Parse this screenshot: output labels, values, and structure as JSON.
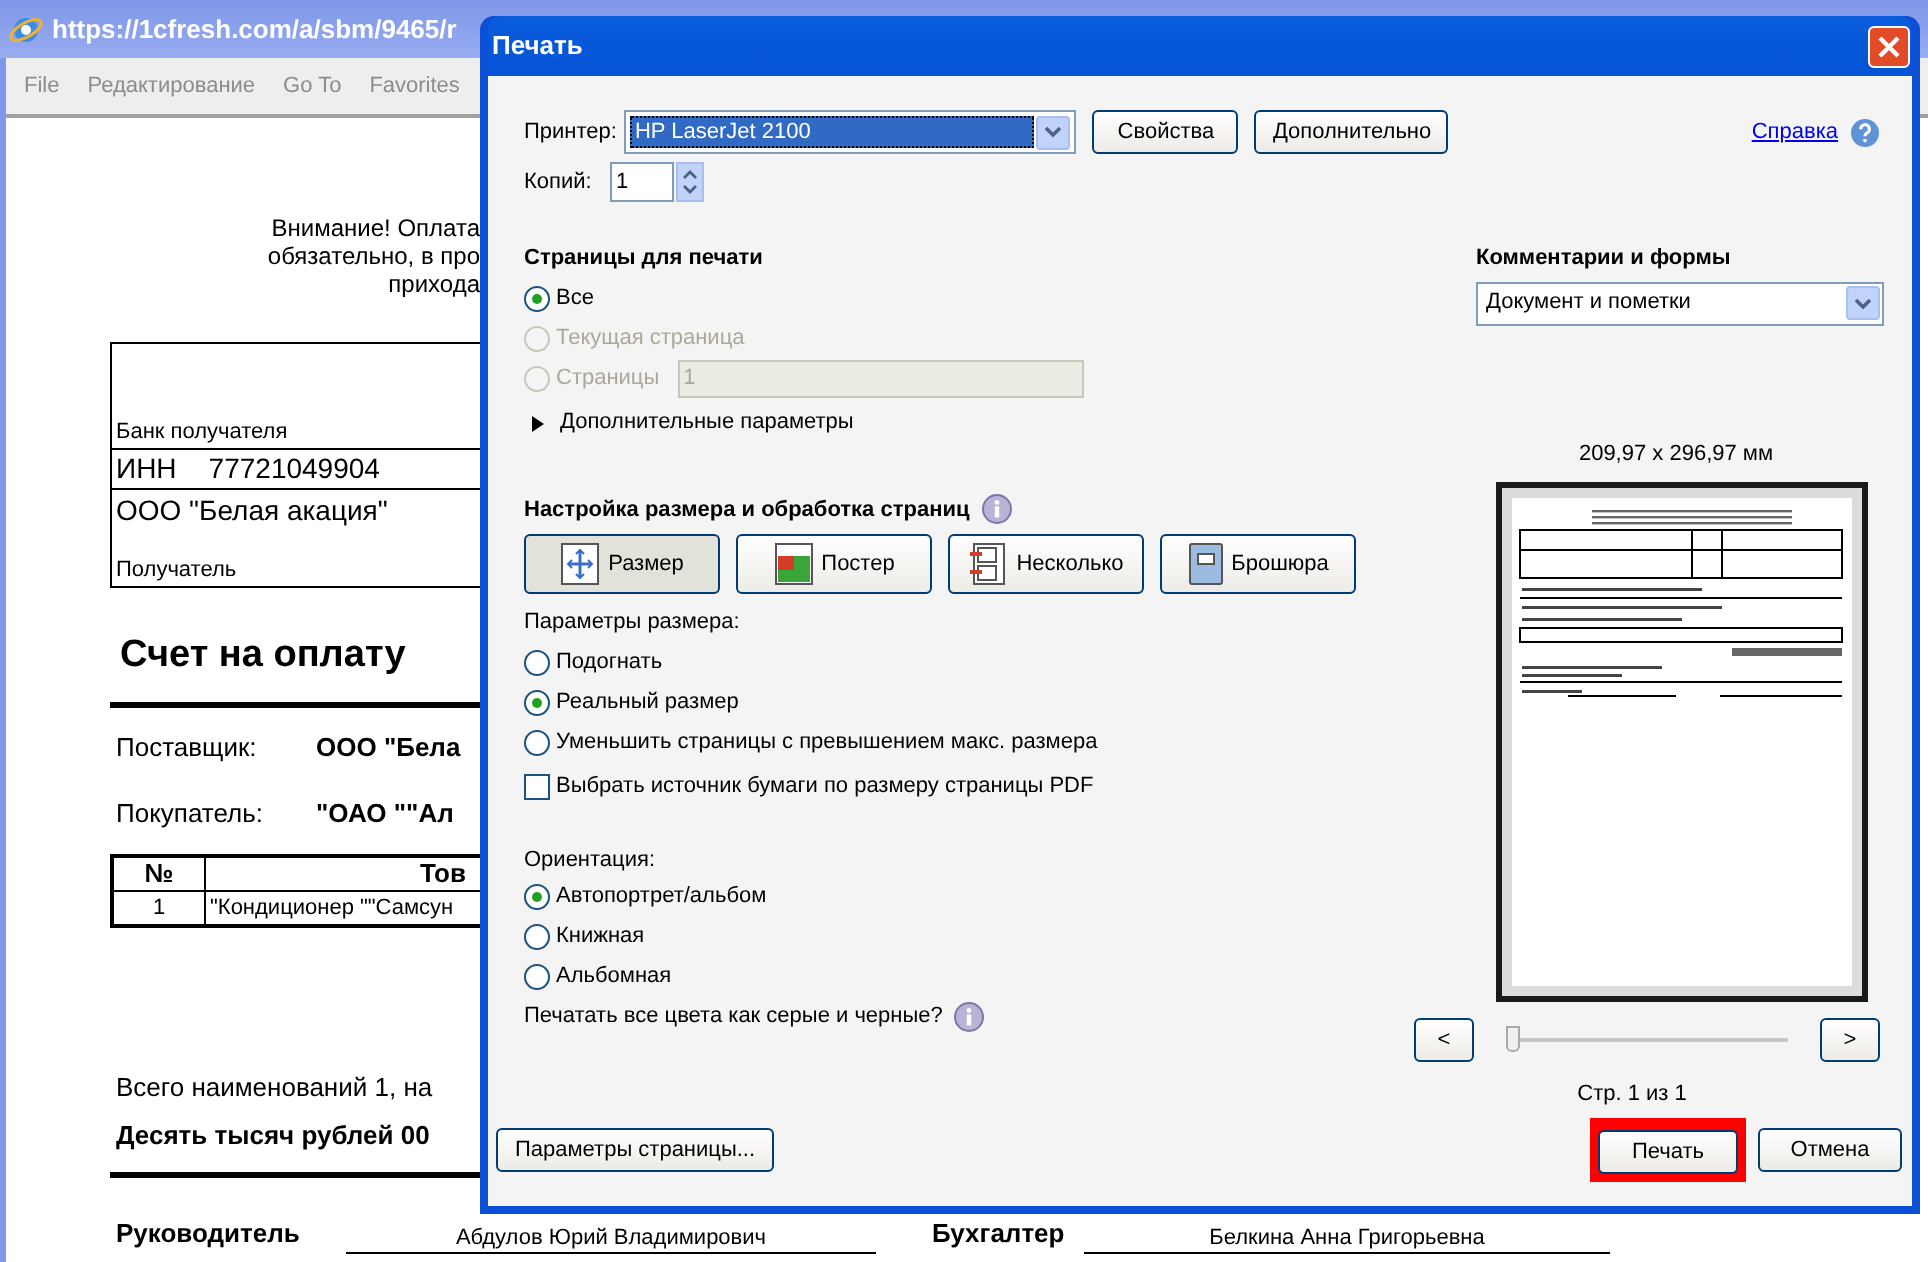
{
  "browser": {
    "address": "https://1cfresh.com/a/sbm/9465/r",
    "menu": [
      "File",
      "Редактирование",
      "Go To",
      "Favorites"
    ]
  },
  "document": {
    "notice": [
      "Внимание! Оплата",
      "обязательно, в про",
      "прихода"
    ],
    "bank_table": {
      "bank_label": "Банк получателя",
      "inn_label": "ИНН",
      "inn_value": "77721049904",
      "recipient_name": "ООО \"Белая акация\"",
      "recipient_label": "Получатель"
    },
    "title": "Счет на оплату",
    "parties": [
      {
        "label": "Поставщик:",
        "value": "ООО \"Бела"
      },
      {
        "label": "Покупатель:",
        "value": "\"ОАО \"\"Ал"
      }
    ],
    "items_table": {
      "columns": [
        "№",
        "Тов"
      ],
      "rows": [
        [
          "1",
          "\"Кондиционер \"\"Самсун"
        ]
      ]
    },
    "totals": [
      "Всего наименований 1, на",
      "Десять тысяч рублей 00"
    ],
    "signatures": [
      {
        "role": "Руководитель",
        "name": "Абдулов Юрий Владимирович"
      },
      {
        "role": "Бухгалтер",
        "name": "Белкина Анна Григорьевна"
      }
    ]
  },
  "dialog": {
    "title": "Печать",
    "printer_label": "Принтер:",
    "printer": "HP LaserJet 2100",
    "buttons_top": [
      "Свойства",
      "Дополнительно"
    ],
    "help_link": "Справка",
    "copies_label": "Копий:",
    "copies": "1",
    "pages_heading": "Страницы для печати",
    "pages": [
      {
        "label": "Все",
        "selected": true,
        "disabled": false
      },
      {
        "label": "Текущая страница",
        "selected": false,
        "disabled": true
      },
      {
        "label": "Страницы",
        "selected": false,
        "disabled": true,
        "field": "1"
      }
    ],
    "more_options": "Дополнительные параметры",
    "sizing_heading": "Настройка размера и обработка страниц",
    "sizing_modes": [
      {
        "label": "Размер",
        "kind": "size",
        "selected": true
      },
      {
        "label": "Постер",
        "kind": "poster",
        "selected": false
      },
      {
        "label": "Несколько",
        "kind": "multiple",
        "selected": false
      },
      {
        "label": "Брошюра",
        "kind": "booklet",
        "selected": false
      }
    ],
    "size_params_label": "Параметры размера:",
    "size_params": [
      {
        "kind": "radio",
        "label": "Подогнать",
        "selected": false
      },
      {
        "kind": "radio",
        "label": "Реальный размер",
        "selected": true
      },
      {
        "kind": "radio",
        "label": "Уменьшить страницы с превышением макс. размера",
        "selected": false
      },
      {
        "kind": "checkbox",
        "label": "Выбрать источник бумаги по размеру страницы PDF",
        "checked": false
      }
    ],
    "orientation_label": "Ориентация:",
    "orientation": [
      {
        "label": "Автопортрет/альбом",
        "selected": true
      },
      {
        "label": "Книжная",
        "selected": false
      },
      {
        "label": "Альбомная",
        "selected": false
      }
    ],
    "grayscale_label": "Печатать все цвета как серые и черные?",
    "comments_heading": "Комментарии и формы",
    "comments_value": "Документ и пометки",
    "page_size": "209,97 x 296,97 мм",
    "prev": "<",
    "next": ">",
    "page_slider": {
      "level": 0
    },
    "page_counter": "Стр. 1 из 1",
    "page_setup_button": "Параметры страницы...",
    "print_button": {
      "label": "Печать",
      "highlighted": true
    },
    "cancel_button": "Отмена"
  }
}
